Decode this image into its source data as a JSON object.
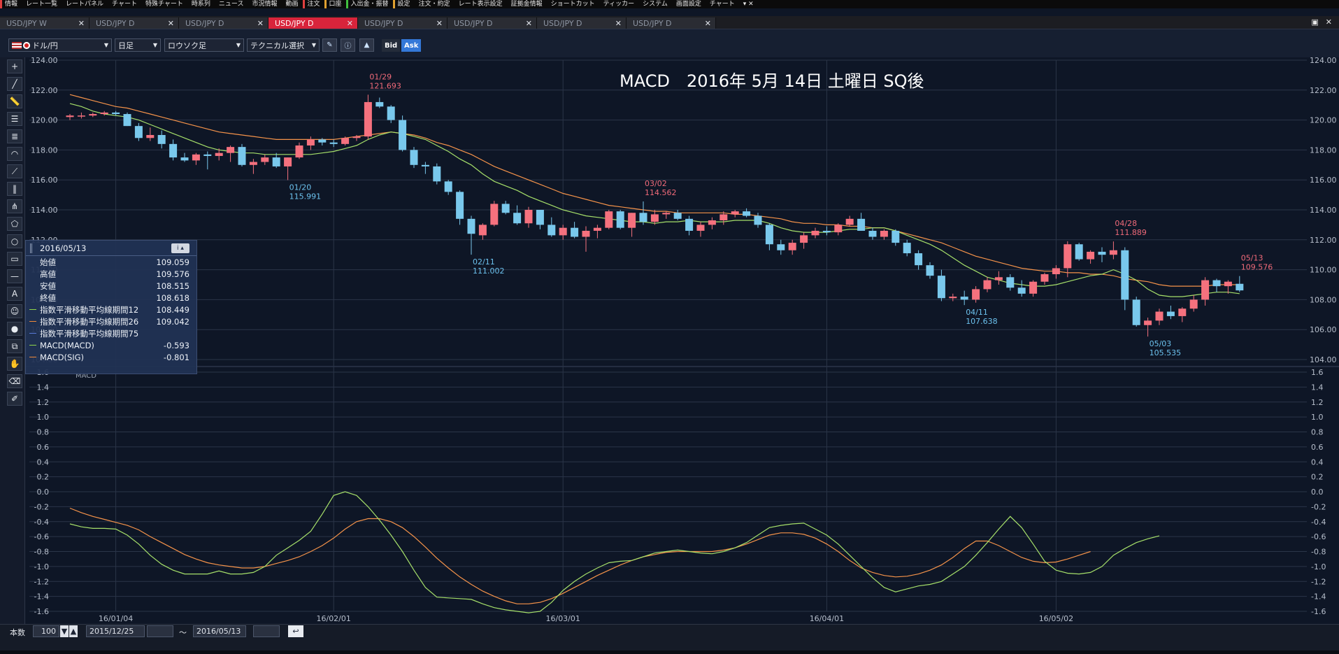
{
  "menu": [
    "情報",
    "レート一覧",
    "レートパネル",
    "チャート",
    "特殊チャート",
    "時系列",
    "ニュース",
    "市況情報",
    "動画",
    "注文",
    "口座",
    "入出金・振替",
    "設定",
    "注文・約定",
    "レート表示設定",
    "証拠金情報",
    "ショートカット",
    "ティッカー",
    "システム",
    "画面設定",
    "チャート"
  ],
  "tabs": [
    "USD/JPY W",
    "USD/JPY D",
    "USD/JPY D",
    "USD/JPY D",
    "USD/JPY D",
    "USD/JPY D",
    "USD/JPY D",
    "USD/JPY D"
  ],
  "active_tab": 3,
  "toolbar": {
    "pair": "ドル/円",
    "timeframe": "日足",
    "chart_type": "ロウソク足",
    "technical": "テクニカル選択",
    "bid": "Bid",
    "ask": "Ask"
  },
  "chart_data": {
    "type": "candlestick",
    "title": "MACD　2016年 5月 14日 土曜日 SQ後",
    "price_axis": {
      "min": 104,
      "max": 124,
      "ticks": [
        "124.00",
        "122.00",
        "120.00",
        "118.00",
        "116.00",
        "114.00",
        "112.00",
        "110.00",
        "108.00",
        "106.00",
        "104.00"
      ]
    },
    "macd_axis": {
      "label": "MACD",
      "min": -1.6,
      "max": 1.6,
      "ticks": [
        "1.6",
        "1.4",
        "1.2",
        "1.0",
        "0.8",
        "0.6",
        "0.4",
        "0.2",
        "0.0",
        "-0.2",
        "-0.4",
        "-0.6",
        "-0.8",
        "-1.0",
        "-1.2",
        "-1.4",
        "-1.6"
      ]
    },
    "date_ticks": [
      {
        "label": "16/01/04",
        "index": 4
      },
      {
        "label": "16/02/01",
        "index": 23
      },
      {
        "label": "16/03/01",
        "index": 43
      },
      {
        "label": "16/04/01",
        "index": 66
      },
      {
        "label": "16/05/02",
        "index": 86
      }
    ],
    "candles": [
      [
        120.2,
        120.4,
        120.0,
        120.3
      ],
      [
        120.3,
        120.5,
        120.1,
        120.3
      ],
      [
        120.3,
        120.5,
        120.2,
        120.4
      ],
      [
        120.4,
        120.6,
        120.3,
        120.5
      ],
      [
        120.5,
        120.6,
        120.3,
        120.4
      ],
      [
        120.4,
        120.5,
        119.6,
        119.6
      ],
      [
        119.6,
        119.8,
        118.6,
        118.8
      ],
      [
        118.8,
        119.5,
        118.6,
        119.0
      ],
      [
        119.0,
        119.3,
        118.1,
        118.4
      ],
      [
        118.4,
        118.7,
        117.3,
        117.5
      ],
      [
        117.5,
        117.8,
        117.2,
        117.3
      ],
      [
        117.3,
        117.8,
        117.0,
        117.7
      ],
      [
        117.7,
        117.9,
        116.7,
        117.6
      ],
      [
        117.6,
        118.1,
        117.3,
        117.8
      ],
      [
        117.8,
        118.3,
        117.2,
        118.2
      ],
      [
        118.2,
        118.4,
        116.9,
        117.0
      ],
      [
        117.0,
        117.4,
        116.4,
        117.2
      ],
      [
        117.2,
        117.7,
        117.0,
        117.5
      ],
      [
        117.5,
        117.8,
        116.8,
        116.9
      ],
      [
        116.9,
        117.5,
        115.991,
        117.5
      ],
      [
        117.5,
        118.5,
        117.4,
        118.3
      ],
      [
        118.3,
        118.9,
        118.0,
        118.7
      ],
      [
        118.7,
        118.8,
        118.3,
        118.5
      ],
      [
        118.5,
        118.7,
        118.2,
        118.4
      ],
      [
        118.4,
        118.9,
        118.3,
        118.8
      ],
      [
        118.8,
        119.0,
        118.6,
        118.9
      ],
      [
        118.9,
        121.693,
        118.7,
        121.2
      ],
      [
        121.2,
        121.5,
        120.8,
        120.9
      ],
      [
        120.9,
        121.0,
        119.8,
        120.0
      ],
      [
        120.0,
        120.3,
        117.9,
        118.0
      ],
      [
        118.0,
        118.2,
        116.8,
        117.0
      ],
      [
        117.0,
        117.2,
        116.4,
        116.9
      ],
      [
        116.9,
        117.1,
        115.7,
        115.9
      ],
      [
        115.9,
        116.0,
        115.0,
        115.2
      ],
      [
        115.2,
        115.3,
        113.0,
        113.4
      ],
      [
        113.4,
        113.6,
        111.002,
        112.4
      ],
      [
        112.3,
        113.1,
        112.0,
        113.0
      ],
      [
        113.0,
        114.6,
        112.9,
        114.4
      ],
      [
        114.4,
        114.6,
        113.7,
        113.8
      ],
      [
        113.8,
        114.3,
        113.0,
        113.1
      ],
      [
        113.1,
        114.2,
        112.8,
        114.0
      ],
      [
        114.0,
        114.0,
        112.7,
        113.0
      ],
      [
        113.0,
        113.5,
        112.2,
        112.3
      ],
      [
        112.3,
        113.0,
        112.0,
        112.8
      ],
      [
        112.8,
        113.2,
        112.1,
        112.2
      ],
      [
        112.2,
        112.9,
        111.2,
        112.6
      ],
      [
        112.6,
        113.0,
        112.1,
        112.8
      ],
      [
        112.8,
        114.0,
        112.7,
        113.9
      ],
      [
        113.9,
        114.0,
        112.7,
        112.8
      ],
      [
        112.8,
        113.8,
        112.2,
        113.8
      ],
      [
        113.8,
        114.562,
        113.0,
        113.2
      ],
      [
        113.2,
        114.0,
        113.0,
        113.7
      ],
      [
        113.7,
        113.9,
        113.4,
        113.8
      ],
      [
        113.8,
        114.0,
        113.3,
        113.4
      ],
      [
        113.4,
        113.6,
        112.3,
        112.6
      ],
      [
        112.6,
        113.2,
        112.2,
        113.0
      ],
      [
        113.0,
        113.5,
        112.7,
        113.3
      ],
      [
        113.3,
        113.9,
        113.0,
        113.7
      ],
      [
        113.7,
        114.0,
        113.5,
        113.9
      ],
      [
        113.9,
        114.1,
        113.5,
        113.6
      ],
      [
        113.6,
        113.8,
        112.8,
        113.0
      ],
      [
        113.0,
        113.1,
        111.3,
        111.7
      ],
      [
        111.7,
        112.0,
        111.0,
        111.3
      ],
      [
        111.3,
        112.0,
        111.0,
        111.8
      ],
      [
        111.8,
        112.5,
        111.4,
        112.3
      ],
      [
        112.3,
        112.8,
        112.1,
        112.6
      ],
      [
        112.6,
        112.9,
        112.3,
        112.5
      ],
      [
        112.5,
        113.1,
        112.3,
        113.0
      ],
      [
        113.0,
        113.6,
        112.9,
        113.4
      ],
      [
        113.4,
        113.8,
        112.6,
        112.6
      ],
      [
        112.6,
        112.8,
        112.0,
        112.2
      ],
      [
        112.2,
        112.7,
        112.0,
        112.6
      ],
      [
        112.6,
        112.7,
        111.6,
        111.8
      ],
      [
        111.8,
        112.0,
        110.9,
        111.1
      ],
      [
        111.1,
        111.3,
        110.0,
        110.3
      ],
      [
        110.3,
        110.5,
        109.4,
        109.6
      ],
      [
        109.6,
        110.0,
        107.9,
        108.1
      ],
      [
        108.1,
        108.4,
        107.9,
        108.2
      ],
      [
        108.2,
        108.6,
        107.638,
        108.0
      ],
      [
        108.0,
        108.9,
        107.8,
        108.7
      ],
      [
        108.7,
        109.5,
        108.5,
        109.3
      ],
      [
        109.3,
        109.9,
        109.0,
        109.5
      ],
      [
        109.5,
        109.7,
        108.6,
        108.8
      ],
      [
        108.8,
        109.3,
        108.2,
        108.4
      ],
      [
        108.4,
        109.3,
        108.2,
        109.2
      ],
      [
        109.2,
        109.8,
        109.0,
        109.7
      ],
      [
        109.7,
        110.3,
        109.4,
        110.1
      ],
      [
        110.1,
        111.9,
        109.5,
        111.7
      ],
      [
        111.7,
        111.8,
        110.6,
        110.7
      ],
      [
        110.7,
        111.3,
        110.4,
        111.2
      ],
      [
        111.2,
        111.5,
        110.5,
        111.0
      ],
      [
        111.0,
        111.889,
        110.7,
        111.3
      ],
      [
        111.3,
        111.5,
        107.3,
        108.0
      ],
      [
        108.0,
        108.2,
        106.2,
        106.3
      ],
      [
        106.3,
        106.8,
        105.535,
        106.6
      ],
      [
        106.6,
        107.4,
        106.3,
        107.2
      ],
      [
        107.2,
        107.6,
        106.7,
        106.9
      ],
      [
        106.9,
        107.5,
        106.5,
        107.4
      ],
      [
        107.4,
        108.3,
        107.2,
        108.0
      ],
      [
        108.0,
        109.5,
        107.6,
        109.3
      ],
      [
        109.3,
        109.4,
        108.5,
        108.9
      ],
      [
        108.9,
        109.3,
        108.4,
        109.2
      ],
      [
        109.059,
        109.576,
        108.515,
        108.618
      ]
    ],
    "annotations": [
      {
        "index": 19,
        "date": "01/20",
        "value": "115.991",
        "type": "low"
      },
      {
        "index": 26,
        "date": "01/29",
        "value": "121.693",
        "type": "high"
      },
      {
        "index": 35,
        "date": "02/11",
        "value": "111.002",
        "type": "low"
      },
      {
        "index": 50,
        "date": "03/02",
        "value": "114.562",
        "type": "high"
      },
      {
        "index": 78,
        "date": "04/11",
        "value": "107.638",
        "type": "low"
      },
      {
        "index": 91,
        "date": "04/28",
        "value": "111.889",
        "type": "high"
      },
      {
        "index": 94,
        "date": "05/03",
        "value": "105.535",
        "type": "low"
      },
      {
        "index": 102,
        "date": "05/13",
        "value": "109.576",
        "type": "high"
      }
    ],
    "ema12": [
      121.1,
      120.9,
      120.6,
      120.4,
      120.3,
      120.2,
      120.0,
      119.7,
      119.4,
      119.1,
      118.8,
      118.5,
      118.2,
      118.0,
      117.9,
      117.8,
      117.8,
      117.7,
      117.7,
      117.7,
      117.7,
      117.7,
      117.8,
      117.9,
      118.1,
      118.3,
      118.7,
      119.0,
      119.2,
      119.1,
      118.9,
      118.7,
      118.3,
      117.9,
      117.4,
      117.0,
      116.4,
      115.9,
      115.6,
      115.3,
      114.9,
      114.6,
      114.3,
      114.0,
      113.8,
      113.6,
      113.5,
      113.4,
      113.3,
      113.2,
      113.2,
      113.1,
      113.2,
      113.2,
      113.3,
      113.2,
      113.2,
      113.2,
      113.3,
      113.3,
      113.3,
      113.1,
      112.8,
      112.6,
      112.5,
      112.5,
      112.5,
      112.6,
      112.7,
      112.7,
      112.8,
      112.8,
      112.6,
      112.3,
      112.0,
      111.7,
      111.3,
      110.8,
      110.3,
      109.9,
      109.5,
      109.3,
      109.1,
      109.0,
      108.9,
      108.9,
      109.0,
      109.2,
      109.4,
      109.6,
      109.7,
      110.0,
      109.7,
      109.3,
      108.7,
      108.3,
      108.2,
      108.2,
      108.3,
      108.4,
      108.5,
      108.5,
      108.4
    ],
    "ema26": [
      121.7,
      121.5,
      121.3,
      121.1,
      120.9,
      120.8,
      120.6,
      120.4,
      120.2,
      120.0,
      119.8,
      119.6,
      119.4,
      119.2,
      119.1,
      119.0,
      118.9,
      118.8,
      118.7,
      118.7,
      118.7,
      118.7,
      118.7,
      118.7,
      118.8,
      118.9,
      119.0,
      119.1,
      119.2,
      119.1,
      119.0,
      118.8,
      118.5,
      118.3,
      118.0,
      117.7,
      117.3,
      116.9,
      116.6,
      116.3,
      116.0,
      115.7,
      115.4,
      115.1,
      114.9,
      114.7,
      114.5,
      114.3,
      114.2,
      114.1,
      114.0,
      113.9,
      113.9,
      113.8,
      113.8,
      113.8,
      113.8,
      113.8,
      113.7,
      113.7,
      113.6,
      113.5,
      113.4,
      113.2,
      113.1,
      113.1,
      113.0,
      113.0,
      112.9,
      112.9,
      112.8,
      112.8,
      112.6,
      112.4,
      112.2,
      112.0,
      111.8,
      111.5,
      111.2,
      110.9,
      110.7,
      110.5,
      110.3,
      110.1,
      110.0,
      109.9,
      109.9,
      109.8,
      109.8,
      109.7,
      109.7,
      109.6,
      109.4,
      109.3,
      109.2,
      109.0,
      108.9,
      108.9,
      108.9,
      108.9,
      109.0,
      109.0,
      109.0
    ],
    "macd": [
      -0.43,
      -0.47,
      -0.49,
      -0.49,
      -0.5,
      -0.58,
      -0.7,
      -0.85,
      -0.97,
      -1.05,
      -1.1,
      -1.1,
      -1.1,
      -1.06,
      -1.1,
      -1.1,
      -1.08,
      -1.0,
      -0.85,
      -0.75,
      -0.65,
      -0.53,
      -0.3,
      -0.05,
      0.0,
      -0.05,
      -0.2,
      -0.38,
      -0.58,
      -0.8,
      -1.05,
      -1.28,
      -1.41,
      -1.42,
      -1.43,
      -1.44,
      -1.5,
      -1.55,
      -1.58,
      -1.6,
      -1.62,
      -1.6,
      -1.48,
      -1.32,
      -1.2,
      -1.1,
      -1.02,
      -0.95,
      -0.93,
      -0.92,
      -0.87,
      -0.82,
      -0.8,
      -0.78,
      -0.8,
      -0.82,
      -0.83,
      -0.8,
      -0.75,
      -0.68,
      -0.58,
      -0.48,
      -0.45,
      -0.43,
      -0.42,
      -0.5,
      -0.58,
      -0.7,
      -0.85,
      -1.0,
      -1.15,
      -1.28,
      -1.34,
      -1.3,
      -1.26,
      -1.24,
      -1.2,
      -1.1,
      -1.0,
      -0.85,
      -0.68,
      -0.5,
      -0.33,
      -0.48,
      -0.7,
      -0.93,
      -1.05,
      -1.09,
      -1.1,
      -1.08,
      -1.0,
      -0.85,
      -0.76,
      -0.68,
      -0.63,
      -0.59
    ],
    "signal": [
      -0.22,
      -0.28,
      -0.33,
      -0.37,
      -0.41,
      -0.45,
      -0.51,
      -0.6,
      -0.68,
      -0.76,
      -0.84,
      -0.9,
      -0.95,
      -0.98,
      -1.0,
      -1.02,
      -1.02,
      -1.0,
      -0.96,
      -0.92,
      -0.87,
      -0.8,
      -0.72,
      -0.62,
      -0.5,
      -0.4,
      -0.36,
      -0.36,
      -0.4,
      -0.48,
      -0.6,
      -0.74,
      -0.89,
      -1.02,
      -1.14,
      -1.24,
      -1.33,
      -1.4,
      -1.46,
      -1.5,
      -1.5,
      -1.48,
      -1.43,
      -1.36,
      -1.28,
      -1.2,
      -1.12,
      -1.05,
      -0.98,
      -0.92,
      -0.87,
      -0.84,
      -0.81,
      -0.8,
      -0.8,
      -0.8,
      -0.8,
      -0.78,
      -0.75,
      -0.7,
      -0.64,
      -0.58,
      -0.55,
      -0.55,
      -0.57,
      -0.62,
      -0.7,
      -0.8,
      -0.92,
      -1.02,
      -1.08,
      -1.12,
      -1.14,
      -1.13,
      -1.1,
      -1.05,
      -0.98,
      -0.88,
      -0.76,
      -0.66,
      -0.66,
      -0.72,
      -0.8,
      -0.88,
      -0.93,
      -0.95,
      -0.94,
      -0.9,
      -0.85,
      -0.8
    ]
  },
  "info_panel": {
    "date": "2016/05/13",
    "rows": [
      {
        "label": "始値",
        "value": "109.059",
        "color": ""
      },
      {
        "label": "高値",
        "value": "109.576",
        "color": ""
      },
      {
        "label": "安値",
        "value": "108.515",
        "color": ""
      },
      {
        "label": "終値",
        "value": "108.618",
        "color": ""
      },
      {
        "label": "指数平滑移動平均線期間12",
        "value": "108.449",
        "color": "#8fd64a"
      },
      {
        "label": "指数平滑移動平均線期間26",
        "value": "109.042",
        "color": "#f08a3a"
      },
      {
        "label": "指数平滑移動平均線期間75",
        "value": "",
        "color": "#5a7bd8"
      },
      {
        "label": "MACD(MACD)",
        "value": "-0.593",
        "color": "#8fd64a"
      },
      {
        "label": "MACD(SIG)",
        "value": "-0.801",
        "color": "#f08a3a"
      }
    ]
  },
  "status": {
    "count_label": "本数",
    "count_value": "100",
    "from_date": "2015/12/25",
    "tilde": "～",
    "to_date": "2016/05/13"
  },
  "colors": {
    "up": "#f5717e",
    "down": "#79c8ec",
    "ema12": "#a6e06a",
    "ema26": "#f5934a",
    "background": "#0e1626",
    "grid": "#2b3548"
  }
}
